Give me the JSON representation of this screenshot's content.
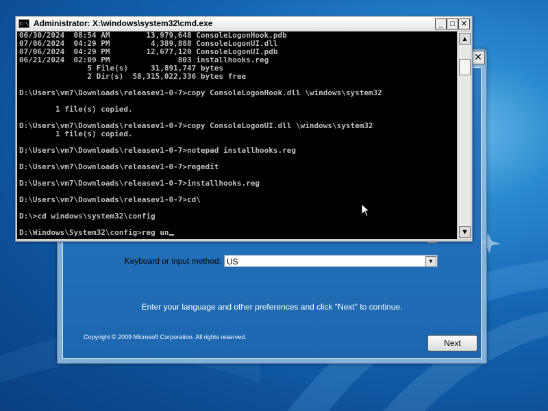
{
  "cmd": {
    "title": "Administrator: X:\\windows\\system32\\cmd.exe",
    "icon_text": "C:\\",
    "minimize_label": "_",
    "maximize_label": "□",
    "close_label": "✕",
    "lines": [
      "06/30/2024  08:54 AM        13,979,648 ConsoleLogonHook.pdb",
      "07/06/2024  04:29 PM         4,389,888 ConsoleLogonUI.dll",
      "07/06/2024  04:29 PM        12,677,120 ConsoleLogonUI.pdb",
      "06/21/2024  02:09 PM               803 installhooks.reg",
      "               5 File(s)     31,891,747 bytes",
      "               2 Dir(s)  58,315,022,336 bytes free",
      "",
      "D:\\Users\\vm7\\Downloads\\releasev1-0-7>copy ConsoleLogonHook.dll \\windows\\system32",
      "",
      "        1 file(s) copied.",
      "",
      "D:\\Users\\vm7\\Downloads\\releasev1-0-7>copy ConsoleLogonUI.dll \\windows\\system32",
      "        1 file(s) copied.",
      "",
      "D:\\Users\\vm7\\Downloads\\releasev1-0-7>notepad installhooks.reg",
      "",
      "D:\\Users\\vm7\\Downloads\\releasev1-0-7>regedit",
      "",
      "D:\\Users\\vm7\\Downloads\\releasev1-0-7>installhooks.reg",
      "",
      "D:\\Users\\vm7\\Downloads\\releasev1-0-7>cd\\",
      "",
      "D:\\>cd windows\\system32\\config",
      "",
      "D:\\Windows\\System32\\config>reg un"
    ],
    "scroll_up": "▲",
    "scroll_down": "▼"
  },
  "setup": {
    "close_label": "✕",
    "keyboard_label": "Keyboard or input method:",
    "keyboard_value": "US",
    "dropdown_arrow": "▼",
    "instruction": "Enter your language and other preferences and click \"Next\" to continue.",
    "copyright": "Copyright © 2009 Microsoft Corporation. All rights reserved.",
    "next_label": "Next"
  },
  "colors": {
    "desktop_blue": "#1566b3",
    "console_bg": "#000000",
    "console_text": "#c0c0c0"
  },
  "icons": [
    "cmd-icon",
    "close-icon",
    "minimize-icon",
    "maximize-icon",
    "chevron-down-icon",
    "arrow-up-icon",
    "arrow-down-icon",
    "mouse-pointer-icon"
  ]
}
